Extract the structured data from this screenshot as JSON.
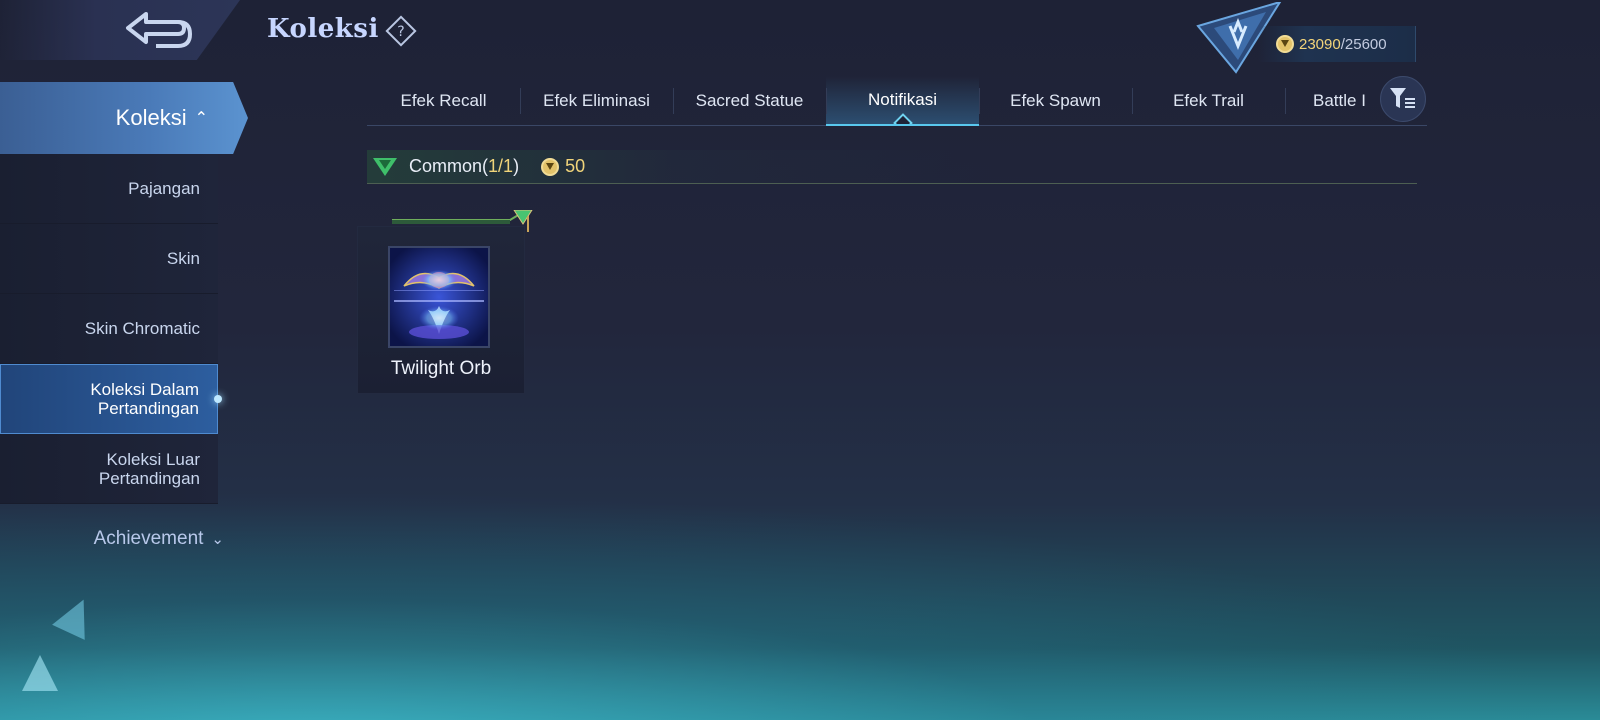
{
  "header": {
    "title": "Koleksi",
    "back_icon": "back-arrow-icon",
    "help_icon": "question-diamond-icon"
  },
  "currency": {
    "current": "23090",
    "separator": "/",
    "max": "25600",
    "icon": "collector-coin-icon"
  },
  "sidebar": {
    "main_label": "Koleksi",
    "items": [
      {
        "label": "Pajangan"
      },
      {
        "label": "Skin"
      },
      {
        "label": "Skin Chromatic"
      },
      {
        "label": "Koleksi Dalam Pertandingan",
        "active": true
      },
      {
        "label": "Koleksi Luar Pertandingan"
      }
    ],
    "achievement_label": "Achievement"
  },
  "tabs": [
    {
      "label": "Efek Recall"
    },
    {
      "label": "Efek Eliminasi"
    },
    {
      "label": "Sacred Statue"
    },
    {
      "label": "Notifikasi",
      "active": true
    },
    {
      "label": "Efek Spawn"
    },
    {
      "label": "Efek Trail"
    },
    {
      "label": "Battle I"
    }
  ],
  "section": {
    "tier": "Common",
    "count_open": "(",
    "count": "1/1",
    "count_close": ")",
    "cost": "50"
  },
  "items": [
    {
      "name": "Twilight Orb"
    }
  ],
  "colors": {
    "accent_blue": "#59c8ee",
    "gold": "#f0d47a",
    "sidebar_active": "#2d5e9f"
  }
}
